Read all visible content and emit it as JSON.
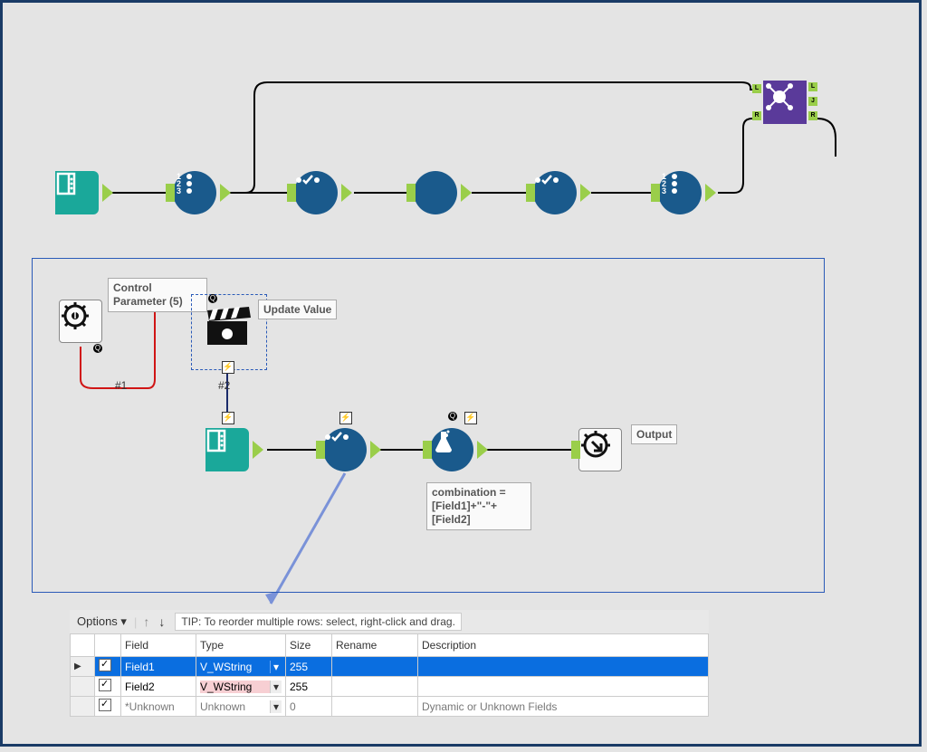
{
  "workflow_row": {
    "tools": [
      "input-data",
      "select-records",
      "filter-1",
      "plain",
      "filter-2",
      "select-records-2",
      "join"
    ],
    "join_anchors": {
      "left": "L",
      "right": "R",
      "join_out": "J"
    }
  },
  "sub_workflow": {
    "control_param_label": "Control Parameter (5)",
    "action_label": "Update Value",
    "formula_expr": "combination = [Field1]+\"-\"+[Field2]",
    "macro_output_label": "Output",
    "conn_labels": {
      "c1": "#1",
      "c2": "#2"
    }
  },
  "config_panel": {
    "options_label": "Options",
    "tip_text": "TIP: To reorder multiple rows: select, right-click and drag.",
    "columns": [
      "",
      "",
      "Field",
      "Type",
      "Size",
      "Rename",
      "Description"
    ],
    "rows": [
      {
        "selected": true,
        "checked": true,
        "field": "Field1",
        "type": "V_WString",
        "size": "255",
        "rename": "",
        "desc": ""
      },
      {
        "selected": false,
        "checked": true,
        "field": "Field2",
        "type": "V_WString",
        "size": "255",
        "rename": "",
        "desc": ""
      },
      {
        "selected": false,
        "checked": true,
        "field": "*Unknown",
        "type": "Unknown",
        "size": "0",
        "rename": "",
        "desc": "Dynamic or Unknown Fields"
      }
    ]
  }
}
